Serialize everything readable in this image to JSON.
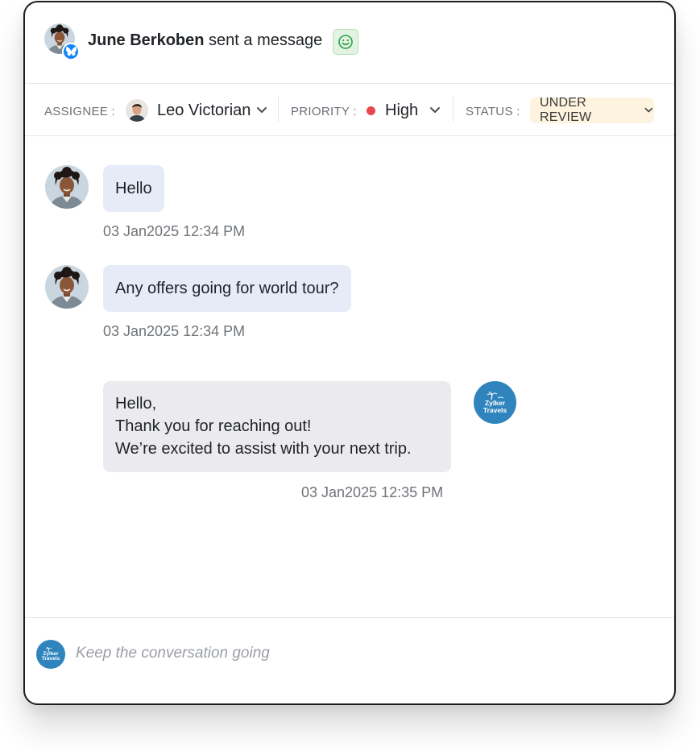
{
  "header": {
    "sender_name": "June Berkoben",
    "action_text": "sent a message",
    "channel_icon": "bluesky-butterfly-icon",
    "reaction_icon": "smiley-icon"
  },
  "toolbar": {
    "assignee_label": "ASSIGNEE :",
    "assignee_name": "Leo Victorian",
    "priority_label": "PRIORITY :",
    "priority_value": "High",
    "priority_color": "#e5484d",
    "status_label": "STATUS :",
    "status_value": "UNDER REVIEW",
    "status_bg": "#fdf3de"
  },
  "messages": [
    {
      "direction": "incoming",
      "text": "Hello",
      "time": "03 Jan2025 12:34 PM"
    },
    {
      "direction": "incoming",
      "text": "Any offers going for world tour?",
      "time": "03 Jan2025 12:34 PM"
    },
    {
      "direction": "outgoing",
      "lines": [
        "Hello,",
        "Thank you for reaching out!",
        "We’re excited to assist with your next trip."
      ],
      "time": "03 Jan2025 12:35 PM"
    }
  ],
  "brand": {
    "line1": "Zylker",
    "line2": "Travels",
    "color": "#2f84bd"
  },
  "composer": {
    "placeholder": "Keep the conversation going"
  }
}
